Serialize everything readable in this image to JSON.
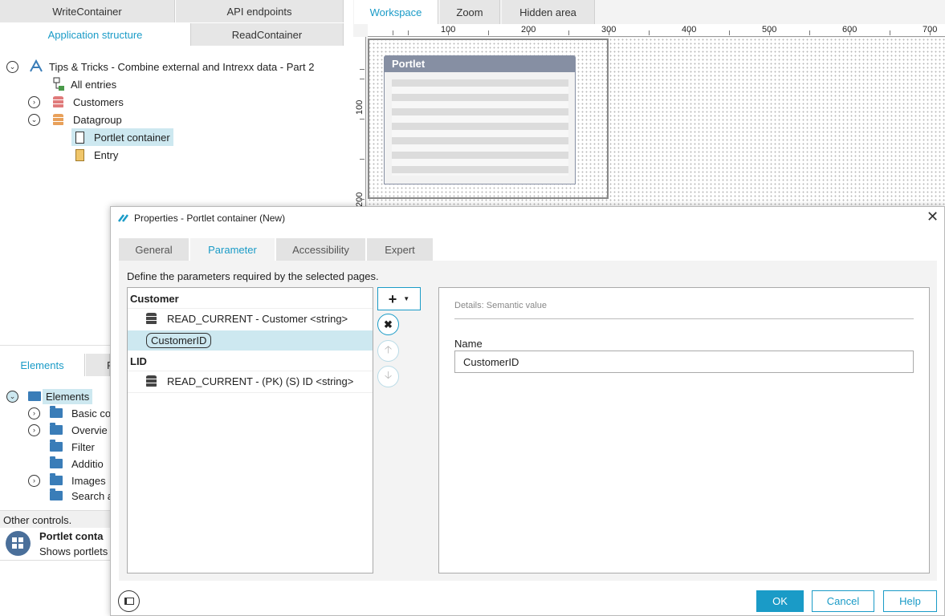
{
  "left_top_tabs": {
    "write_container": "WriteContainer",
    "api_endpoints": "API endpoints",
    "application_structure": "Application structure",
    "read_container": "ReadContainer"
  },
  "tree": {
    "root": "Tips & Tricks - Combine external and Intrexx data - Part 2",
    "all_entries": "All entries",
    "customers": "Customers",
    "datagroup": "Datagroup",
    "portlet_container": "Portlet container",
    "entry": "Entry"
  },
  "workspace_tabs": {
    "workspace": "Workspace",
    "zoom": "Zoom",
    "hidden_area": "Hidden area"
  },
  "ruler": {
    "h_labels": [
      "100",
      "200",
      "300",
      "400",
      "500",
      "600",
      "700"
    ],
    "v_labels": [
      "100",
      "200"
    ]
  },
  "portlet_preview": {
    "title": "Portlet"
  },
  "elements_panel": {
    "tab_elements": "Elements",
    "tab_second": "F",
    "root": "Elements",
    "items": [
      "Basic co",
      "Overvie",
      "Filter",
      "Additio",
      "Images",
      "Search a"
    ],
    "other_controls": "Other controls.",
    "portlet_title": "Portlet conta",
    "portlet_desc": "Shows portlets"
  },
  "dialog": {
    "title": "Properties - Portlet container (New)",
    "tabs": [
      "General",
      "Parameter",
      "Accessibility",
      "Expert"
    ],
    "instruction": "Define the parameters required by the selected pages.",
    "groups": {
      "customer": "Customer",
      "customer_item": "READ_CURRENT - Customer <string>",
      "customer_selected": "CustomerID",
      "lid": "LID",
      "lid_item": "READ_CURRENT - (PK) (S) ID <string>"
    },
    "details_header": "Details: Semantic value",
    "name_label": "Name",
    "name_value": "CustomerID",
    "buttons": {
      "ok": "OK",
      "cancel": "Cancel",
      "help": "Help"
    }
  },
  "colors": {
    "accent": "#1a9bc7",
    "selected_row": "#cde8f0",
    "portlet_header": "#868fa3",
    "customers_db": "#e07a7a",
    "datagroup_db": "#e8a05a",
    "folder": "#3a7db8"
  }
}
